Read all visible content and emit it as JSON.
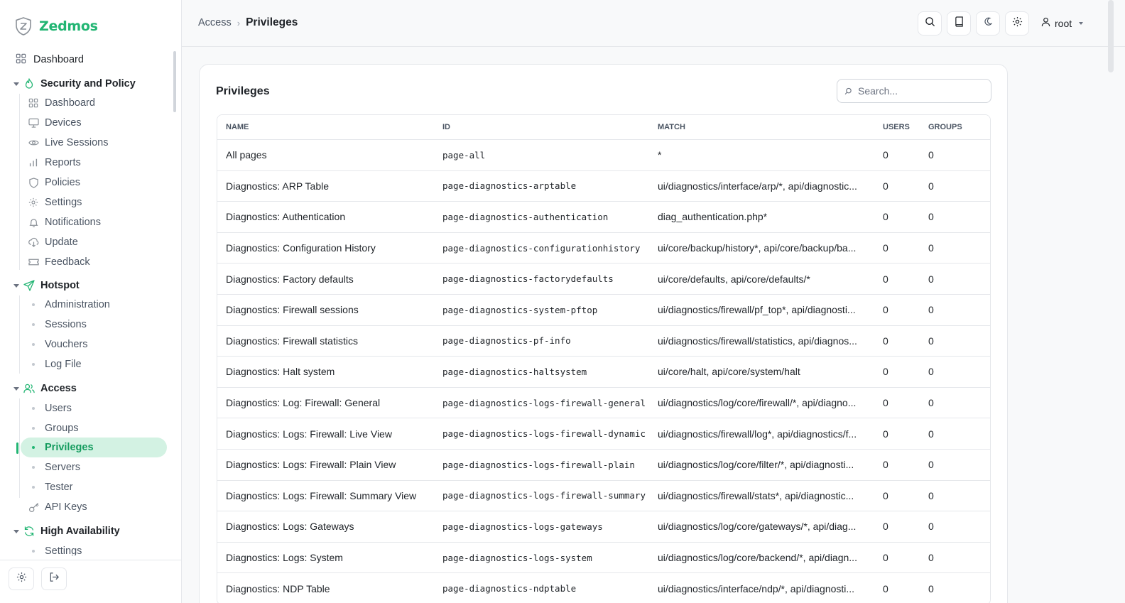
{
  "brand": {
    "name": "Zedmos",
    "accent": "#22b573"
  },
  "sidebar": {
    "top_item": {
      "label": "Dashboard",
      "icon": "grid-icon"
    },
    "groups": [
      {
        "label": "Security and Policy",
        "icon": "flame-icon",
        "items": [
          {
            "label": "Dashboard",
            "icon": "grid-icon"
          },
          {
            "label": "Devices",
            "icon": "monitor-icon"
          },
          {
            "label": "Live Sessions",
            "icon": "eye-icon"
          },
          {
            "label": "Reports",
            "icon": "bar-chart-icon"
          },
          {
            "label": "Policies",
            "icon": "shield-icon"
          },
          {
            "label": "Settings",
            "icon": "gear-icon"
          },
          {
            "label": "Notifications",
            "icon": "bell-icon"
          },
          {
            "label": "Update",
            "icon": "cloud-download-icon"
          },
          {
            "label": "Feedback",
            "icon": "ticket-icon"
          }
        ]
      },
      {
        "label": "Hotspot",
        "icon": "send-icon",
        "items": [
          {
            "label": "Administration"
          },
          {
            "label": "Sessions"
          },
          {
            "label": "Vouchers"
          },
          {
            "label": "Log File"
          }
        ]
      },
      {
        "label": "Access",
        "icon": "users-icon",
        "items": [
          {
            "label": "Users"
          },
          {
            "label": "Groups"
          },
          {
            "label": "Privileges",
            "active": true
          },
          {
            "label": "Servers"
          },
          {
            "label": "Tester"
          },
          {
            "label": "API Keys",
            "icon": "key-icon"
          }
        ]
      },
      {
        "label": "High Availability",
        "icon": "refresh-icon",
        "items": [
          {
            "label": "Settings"
          }
        ]
      }
    ]
  },
  "header": {
    "breadcrumb": {
      "parent": "Access",
      "separator": "›",
      "current": "Privileges"
    },
    "user": "root"
  },
  "card": {
    "title": "Privileges",
    "search_placeholder": "Search..."
  },
  "table": {
    "columns": [
      "NAME",
      "ID",
      "MATCH",
      "USERS",
      "GROUPS"
    ],
    "rows": [
      {
        "name": "All pages",
        "id": "page-all",
        "match": "*",
        "users": "0",
        "groups": "0"
      },
      {
        "name": "Diagnostics: ARP Table",
        "id": "page-diagnostics-arptable",
        "match": "ui/diagnostics/interface/arp/*, api/diagnostic...",
        "users": "0",
        "groups": "0"
      },
      {
        "name": "Diagnostics: Authentication",
        "id": "page-diagnostics-authentication",
        "match": "diag_authentication.php*",
        "users": "0",
        "groups": "0"
      },
      {
        "name": "Diagnostics: Configuration History",
        "id": "page-diagnostics-configurationhistory",
        "match": "ui/core/backup/history*, api/core/backup/ba...",
        "users": "0",
        "groups": "0"
      },
      {
        "name": "Diagnostics: Factory defaults",
        "id": "page-diagnostics-factorydefaults",
        "match": "ui/core/defaults, api/core/defaults/*",
        "users": "0",
        "groups": "0"
      },
      {
        "name": "Diagnostics: Firewall sessions",
        "id": "page-diagnostics-system-pftop",
        "match": "ui/diagnostics/firewall/pf_top*, api/diagnosti...",
        "users": "0",
        "groups": "0"
      },
      {
        "name": "Diagnostics: Firewall statistics",
        "id": "page-diagnostics-pf-info",
        "match": "ui/diagnostics/firewall/statistics, api/diagnos...",
        "users": "0",
        "groups": "0"
      },
      {
        "name": "Diagnostics: Halt system",
        "id": "page-diagnostics-haltsystem",
        "match": "ui/core/halt, api/core/system/halt",
        "users": "0",
        "groups": "0"
      },
      {
        "name": "Diagnostics: Log: Firewall: General",
        "id": "page-diagnostics-logs-firewall-general",
        "match": "ui/diagnostics/log/core/firewall/*, api/diagno...",
        "users": "0",
        "groups": "0"
      },
      {
        "name": "Diagnostics: Logs: Firewall: Live View",
        "id": "page-diagnostics-logs-firewall-dynamic",
        "match": "ui/diagnostics/firewall/log*, api/diagnostics/f...",
        "users": "0",
        "groups": "0"
      },
      {
        "name": "Diagnostics: Logs: Firewall: Plain View",
        "id": "page-diagnostics-logs-firewall-plain",
        "match": "ui/diagnostics/log/core/filter/*, api/diagnosti...",
        "users": "0",
        "groups": "0"
      },
      {
        "name": "Diagnostics: Logs: Firewall: Summary View",
        "id": "page-diagnostics-logs-firewall-summary",
        "match": "ui/diagnostics/firewall/stats*, api/diagnostic...",
        "users": "0",
        "groups": "0"
      },
      {
        "name": "Diagnostics: Logs: Gateways",
        "id": "page-diagnostics-logs-gateways",
        "match": "ui/diagnostics/log/core/gateways/*, api/diag...",
        "users": "0",
        "groups": "0"
      },
      {
        "name": "Diagnostics: Logs: System",
        "id": "page-diagnostics-logs-system",
        "match": "ui/diagnostics/log/core/backend/*, api/diagn...",
        "users": "0",
        "groups": "0"
      },
      {
        "name": "Diagnostics: NDP Table",
        "id": "page-diagnostics-ndptable",
        "match": "ui/diagnostics/interface/ndp/*, api/diagnosti...",
        "users": "0",
        "groups": "0"
      }
    ]
  }
}
